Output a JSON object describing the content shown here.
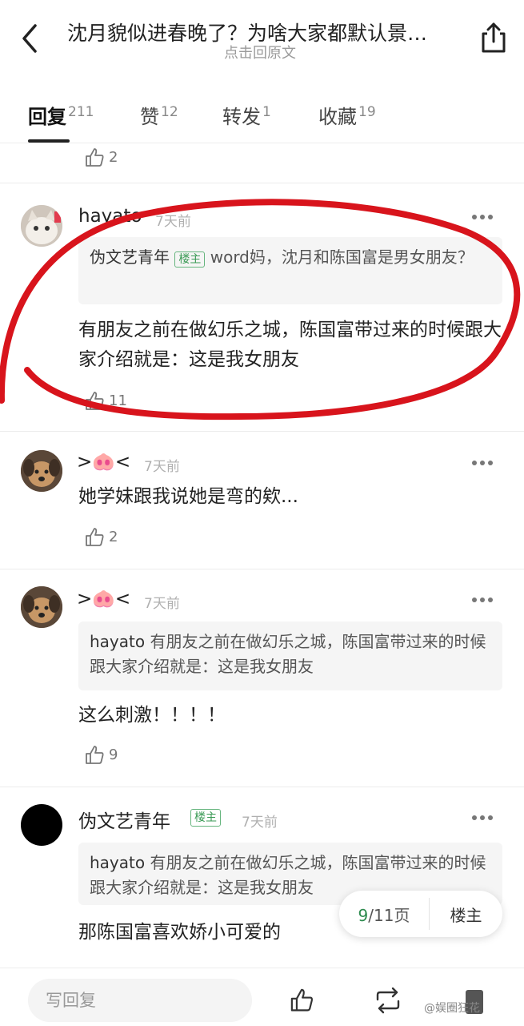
{
  "header": {
    "title": "沈月貌似进春晚了？为啥大家都默认景…",
    "subtitle": "点击回原文"
  },
  "tabs": [
    {
      "label": "回复",
      "count": "211"
    },
    {
      "label": "赞",
      "count": "12"
    },
    {
      "label": "转发",
      "count": "1"
    },
    {
      "label": "收藏",
      "count": "19"
    }
  ],
  "prev_comment": {
    "likes": "2"
  },
  "comments": [
    {
      "username": "hayato",
      "time": "7天前",
      "quote_name": "伪文艺青年",
      "quote_badge": "楼主",
      "quote_text": "word妈，沈月和陈国富是男女朋友？",
      "text": "有朋友之前在做幻乐之城，陈国富带过来的时候跟大家介绍就是：这是我女朋友",
      "likes": "11"
    },
    {
      "username": ">🐽<",
      "time": "7天前",
      "text": "她学妹跟我说她是弯的欸...",
      "likes": "2"
    },
    {
      "username": ">🐽<",
      "time": "7天前",
      "quote_name": "hayato",
      "quote_text": "有朋友之前在做幻乐之城，陈国富带过来的时候跟大家介绍就是：这是我女朋友",
      "text": "这么刺激！！！！",
      "likes": "9"
    },
    {
      "username": "伪文艺青年",
      "badge": "楼主",
      "time": "7天前",
      "quote_name": "hayato",
      "quote_text": "有朋友之前在做幻乐之城，陈国富带过来的时候跟大家介绍就是：这是我女朋友",
      "text": "那陈国富喜欢娇小可爱的"
    }
  ],
  "pager": {
    "current": "9",
    "total": "/11页",
    "op_label": "楼主"
  },
  "bottom": {
    "reply_placeholder": "写回复",
    "watermark": "@娱圈狂花"
  },
  "colors": {
    "accent_green": "#2e8b4f",
    "annotation_red": "#d8141c"
  }
}
